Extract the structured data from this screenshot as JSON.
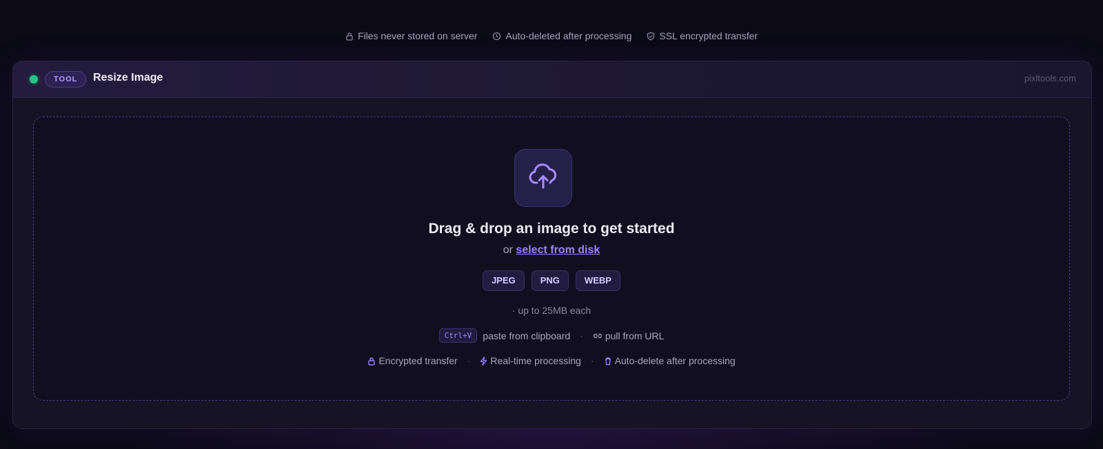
{
  "trust_bar": [
    {
      "label": "Files never stored on server",
      "icon": "lock-icon"
    },
    {
      "label": "Auto-deleted after processing",
      "icon": "clock-icon"
    },
    {
      "label": "SSL encrypted transfer",
      "icon": "shield-icon"
    }
  ],
  "header": {
    "status": "online",
    "badge": "TOOL",
    "title": "Resize Image",
    "domain": "pixltools.com"
  },
  "dropzone": {
    "icon": "cloud-upload-icon",
    "headline": "Drag & drop an image to get started",
    "or_text": "or",
    "select_link": "select from disk",
    "formats": [
      "JPEG",
      "PNG",
      "WEBP"
    ],
    "size_limit": "· up to 25MB each",
    "paste_shortcut": "Ctrl+V",
    "paste_label": "paste from clipboard",
    "url_label": "pull from URL",
    "features": [
      {
        "label": "Encrypted transfer",
        "icon": "lock-icon"
      },
      {
        "label": "Real-time processing",
        "icon": "bolt-icon"
      },
      {
        "label": "Auto-delete after processing",
        "icon": "trash-icon"
      }
    ]
  },
  "colors": {
    "accent": "#9d83ff",
    "status_online": "#22c584",
    "background": "#0b0a16"
  }
}
